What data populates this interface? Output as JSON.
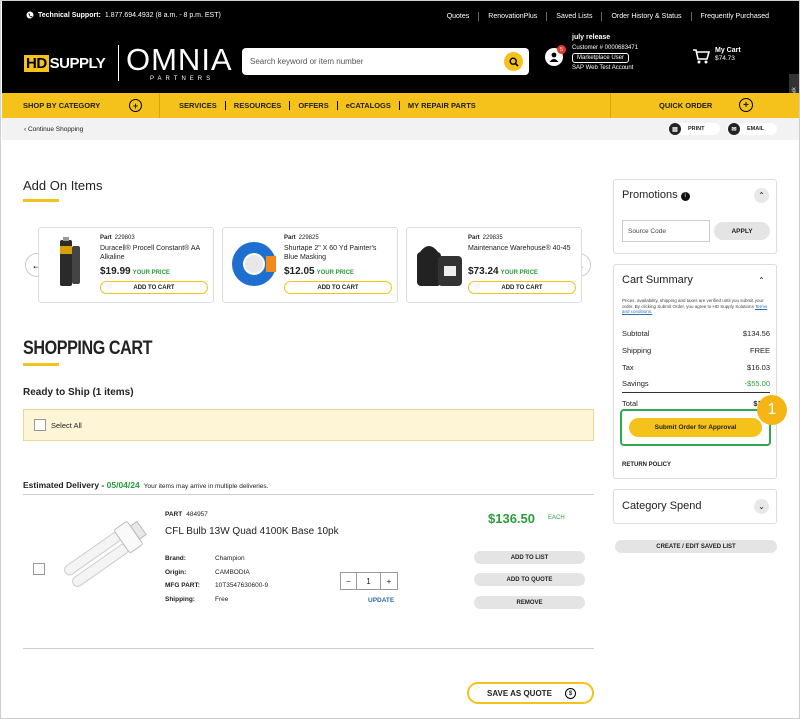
{
  "topbar": {
    "support_label": "Technical Support:",
    "support_details": "1.877.694.4932 (8 a.m. - 8 p.m. EST)",
    "links": [
      "Quotes",
      "RenovationPlus",
      "Saved Lists",
      "Order History & Status",
      "Frequently Purchased"
    ]
  },
  "header": {
    "logo_hd": "HD",
    "logo_supply": "SUPPLY",
    "logo_omnia": "OMNIA",
    "logo_partners": "PARTNERS",
    "search_placeholder": "Search keyword or item number",
    "notification_count": "5",
    "account_name": "july release",
    "account_number": "Customer # 0000683471",
    "account_role": "Marketplace User",
    "account_type": "SAP Web Test Account",
    "cart_label": "My Cart",
    "cart_total": "$74.73",
    "feedback": "Give Feedback"
  },
  "nav": {
    "shop_by_category": "SHOP BY CATEGORY",
    "items": [
      "SERVICES",
      "RESOURCES",
      "OFFERS",
      "eCATALOGS",
      "MY REPAIR PARTS"
    ],
    "quick_order": "QUICK ORDER"
  },
  "subbar": {
    "continue": "‹  Continue Shopping",
    "print": "PRINT",
    "email": "EMAIL"
  },
  "addon": {
    "title": "Add On Items",
    "cards": [
      {
        "part_label": "Part",
        "part": "229803",
        "name": "Duracell® Procell Constant® AA Alkaline",
        "price": "$19.99",
        "price_tag": "YOUR PRICE",
        "button": "ADD TO CART"
      },
      {
        "part_label": "Part",
        "part": "229825",
        "name": "Shurtape 2\" X 60 Yd Painter's Blue Masking",
        "price": "$12.05",
        "price_tag": "YOUR PRICE",
        "button": "ADD TO CART"
      },
      {
        "part_label": "Part",
        "part": "229835",
        "name": "Maintenance Warehouse® 40-45",
        "price": "$73.24",
        "price_tag": "YOUR PRICE",
        "button": "ADD TO CART"
      }
    ]
  },
  "cart": {
    "title": "SHOPPING CART",
    "ready": "Ready to Ship (1 items)",
    "select_all": "Select All",
    "est_label": "Estimated Delivery - ",
    "est_date": "05/04/24",
    "est_note": "Your items may arrive in multiple deliveries.",
    "item": {
      "part_label": "PART",
      "part": "484957",
      "name": "CFL Bulb 13W Quad 4100K Base 10pk",
      "brand_label": "Brand:",
      "brand": "Champion",
      "origin_label": "Origin:",
      "origin": "CAMBODIA",
      "mfg_label": "MFG PART:",
      "mfg": "10T3547630600-9",
      "shipping_label": "Shipping:",
      "shipping": "Free",
      "qty": "1",
      "minus": "−",
      "plus": "+",
      "update": "UPDATE",
      "price": "$136.50",
      "unit": "EACH",
      "add_list": "ADD TO LIST",
      "add_quote": "ADD TO QUOTE",
      "remove": "REMOVE"
    },
    "save_quote": "SAVE AS QUOTE"
  },
  "promotions": {
    "title": "Promotions",
    "info": "i",
    "source_placeholder": "Source Code",
    "apply": "APPLY"
  },
  "summary": {
    "title": "Cart Summary",
    "disclaimer": "Prices, availability, shipping and taxes are verified until you submit your order. By clicking Submit Order, you agree to HD Supply Solutions",
    "terms": "Terms and conditions.",
    "rows": [
      {
        "label": "Subtotal",
        "value": "$134.56"
      },
      {
        "label": "Shipping",
        "value": "FREE"
      },
      {
        "label": "Tax",
        "value": "$16.03"
      },
      {
        "label": "Savings",
        "value": "-$55.00"
      },
      {
        "label": "Total",
        "value": "$150"
      }
    ],
    "submit": "Submit Order for Approval",
    "step": "1",
    "return_policy": "RETURN POLICY"
  },
  "category_spend": {
    "title": "Category Spend"
  },
  "create_list": "CREATE / EDIT SAVED LIST",
  "colors": {
    "brand_yellow": "#f4c21b",
    "price_green": "#2a9d3a",
    "highlight_green": "#2fa84f"
  }
}
